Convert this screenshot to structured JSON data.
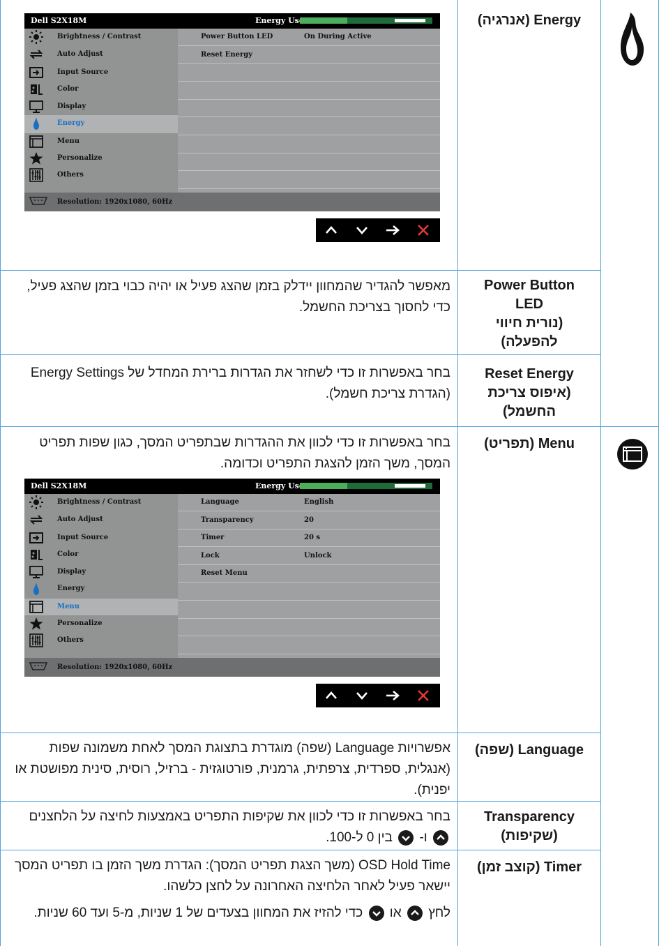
{
  "energy_row": {
    "title": "Energy (אנרגיה)",
    "osd": {
      "model": "Dell S2X18M",
      "energy_use_label": "Energy Use",
      "energy_level": 0.5,
      "menu": [
        "Brightness / Contrast",
        "Auto Adjust",
        "Input Source",
        "Color",
        "Display",
        "Energy",
        "Menu",
        "Personalize",
        "Others"
      ],
      "active_index": 5,
      "rows": [
        {
          "key": "Power Button LED",
          "value": "On During Active"
        },
        {
          "key": "Reset Energy",
          "value": ""
        }
      ],
      "resolution": "Resolution: 1920x1080, 60Hz"
    }
  },
  "power_led": {
    "name_line1": "Power Button",
    "name_line2": "LED",
    "name_line3": "(נורית חיווי",
    "name_line4": "להפעלה)",
    "desc": "מאפשר להגדיר שהמחוון יידלק בזמן שהצג פעיל או יהיה כבוי בזמן שהצג פעיל, כדי לחסוך בצריכת החשמל."
  },
  "reset_energy": {
    "name_line1": "Reset Energy",
    "name_line2": "(איפוס צריכת",
    "name_line3": "החשמל)",
    "desc": "בחר באפשרות זו כדי לשחזר את הגדרות ברירת המחדל של Energy Settings (הגדרת צריכת חשמל)."
  },
  "menu_row": {
    "title": "Menu (תפריט)",
    "desc": "בחר באפשרות זו כדי לכוון את ההגדרות שבתפריט המסך, כגון שפות תפריט המסך, משך הזמן להצגת התפריט וכדומה.",
    "osd": {
      "model": "Dell S2X18M",
      "energy_use_label": "Energy Use",
      "energy_level": 0.5,
      "menu": [
        "Brightness / Contrast",
        "Auto Adjust",
        "Input Source",
        "Color",
        "Display",
        "Energy",
        "Menu",
        "Personalize",
        "Others"
      ],
      "active_index": 6,
      "rows": [
        {
          "key": "Language",
          "value": "English"
        },
        {
          "key": "Transparency",
          "value": "20"
        },
        {
          "key": "Timer",
          "value": "20 s"
        },
        {
          "key": "Lock",
          "value": "Unlock"
        },
        {
          "key": "Reset Menu",
          "value": ""
        }
      ],
      "resolution": "Resolution: 1920x1080, 60Hz"
    }
  },
  "language": {
    "name": "Language (שפה)",
    "desc": "אפשרויות Language (שפה) מוגדרת בתצוגת המסך לאחת משמונה שפות (אנגלית, ספרדית, צרפתית, גרמנית, פורטוגזית - ברזיל, רוסית, סינית מפושטת או יפנית)."
  },
  "transparency": {
    "name_line1": "Transparency",
    "name_line2": "(שקיפות)",
    "desc_a": "בחר באפשרות זו כדי לכוון את שקיפות התפריט באמצעות לחיצה על הלחצנים",
    "desc_b": "ו-",
    "desc_c": "בין 0 ל-100."
  },
  "timer": {
    "name": "Timer (קוצב זמן)",
    "desc1": "OSD Hold Time (משך הצגת תפריט המסך): הגדרת משך הזמן בו תפריט המסך יישאר פעיל לאחר הלחיצה האחרונה על לחצן כלשהו.",
    "desc2_a": "לחץ",
    "desc2_b": "או",
    "desc2_c": "כדי להזיז את המחוון בצעדים של 1 שניות, מ-5 ועד 60 שניות."
  }
}
